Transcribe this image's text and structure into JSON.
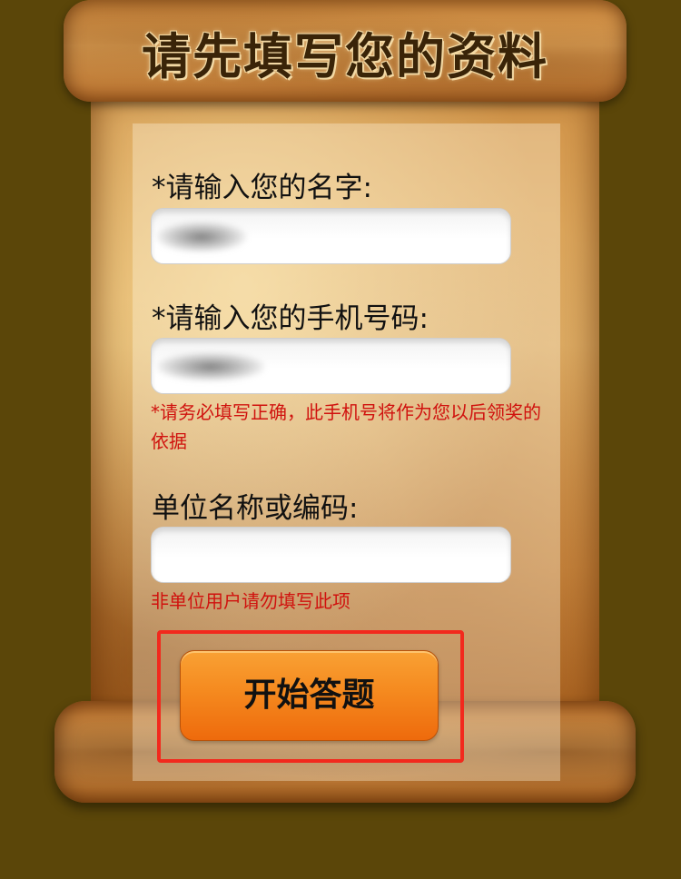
{
  "header": {
    "title": "请先填写您的资料"
  },
  "form": {
    "name_label": "*请输入您的名字:",
    "name_value": "",
    "phone_label": "*请输入您的手机号码:",
    "phone_value": "",
    "phone_hint": "*请务必填写正确，此手机号将作为您以后领奖的依据",
    "org_label": "单位名称或编码:",
    "org_value": "",
    "org_hint": "非单位用户请勿填写此项",
    "submit_label": "开始答题"
  },
  "colors": {
    "background": "#5b4609",
    "hint_text": "#d0120e",
    "button": "#f58a1f",
    "highlight_border": "#f2291d"
  }
}
